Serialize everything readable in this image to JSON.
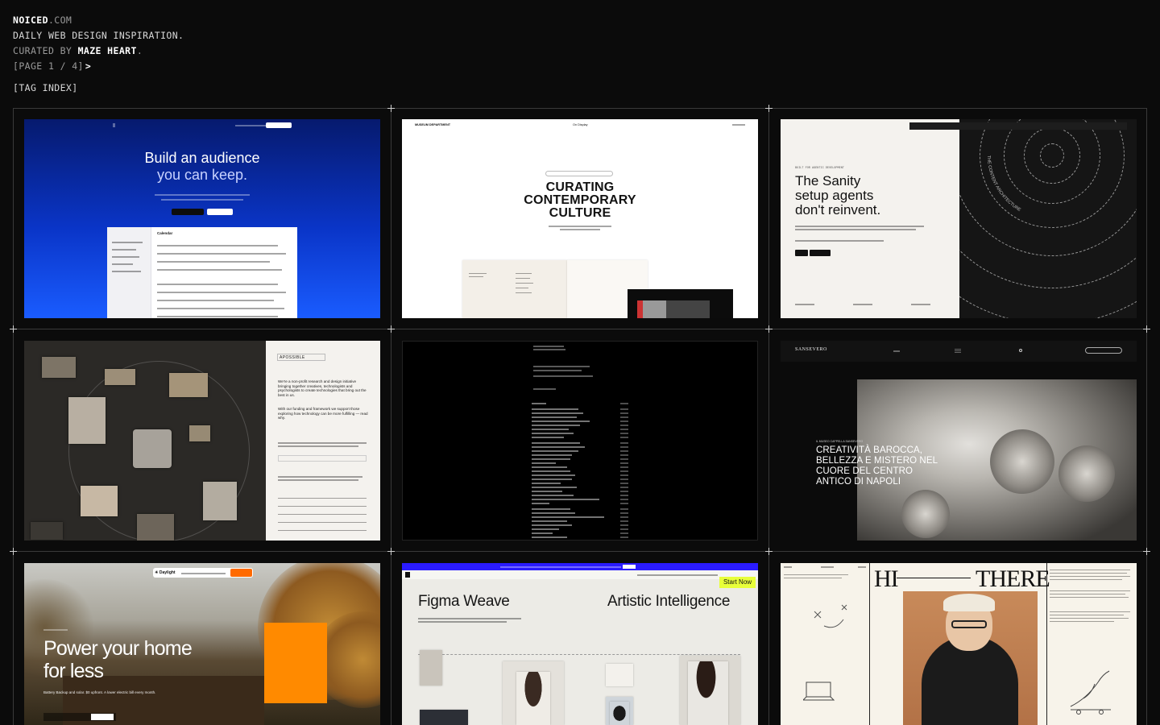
{
  "header": {
    "brand_bold": "NOICED",
    "brand_light": ".COM",
    "tagline": "DAILY WEB DESIGN INSPIRATION.",
    "curated_prefix": "CURATED BY ",
    "curator": "MAZE HEART",
    "curated_suffix": ".",
    "page": "[PAGE 1 / 4]",
    "page_arrow": ">",
    "tag_index": "[TAG INDEX]"
  },
  "cards": [
    {
      "id": "build-an-audience",
      "headline_1": "Build an audience",
      "headline_2": "you can keep.",
      "panel_title": "Calendar"
    },
    {
      "id": "curating-contemporary-culture",
      "brand": "MUSEUM DEPARTMENT",
      "nav_mid": "On Display",
      "headline_1": "CURATING",
      "headline_2": "CONTEMPORARY",
      "headline_3": "CULTURE"
    },
    {
      "id": "sanity",
      "kicker": "BUILT FOR AGENTIC DEVELOPMENT",
      "headline_1": "The Sanity",
      "headline_2": "setup agents",
      "headline_3": "don't reinvent.",
      "spiral_text": "THE CONTENT ARCHITECTURE"
    },
    {
      "id": "a-possible",
      "logo": "APOSSIBLE",
      "intro": "We're a non-profit research and design initiative bringing together creatives, technologists and psychologists to create technologies that bring out the best in us.",
      "intro_2": "With our funding and framework we support those exploring how technology can be more fulfilling — read why."
    },
    {
      "id": "dark-list"
    },
    {
      "id": "sansevero",
      "logo": "SANSEVERO",
      "kicker": "IL MUSEO CAPPELLA SANSEVERO",
      "headline_1": "CREATIVITÀ BAROCCA,",
      "headline_2": "BELLEZZA E MISTERO NEL",
      "headline_3": "CUORE DEL CENTRO",
      "headline_4": "ANTICO DI NAPOLI"
    },
    {
      "id": "daylight",
      "logo": "☀ Daylight",
      "headline_1": "Power your home",
      "headline_2": "for less",
      "sub": "Battery Backup and solar. $0 upfront. A lower electric bill every month."
    },
    {
      "id": "figma-weave",
      "headline_left": "Figma Weave",
      "headline_right": "Artistic Intelligence",
      "start_now": "Start Now"
    },
    {
      "id": "hi-there",
      "hi": "HI",
      "there": "THERE"
    }
  ]
}
